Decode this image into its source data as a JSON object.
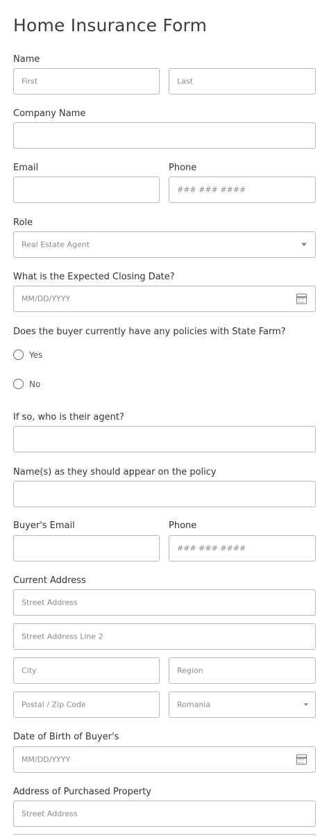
{
  "form": {
    "title": "Home Insurance Form",
    "name": {
      "label": "Name",
      "first_placeholder": "First",
      "last_placeholder": "Last"
    },
    "company": {
      "label": "Company Name"
    },
    "email": {
      "label": "Email"
    },
    "phone": {
      "label": "Phone",
      "placeholder": "### ### ####"
    },
    "role": {
      "label": "Role",
      "selected": "Real Estate Agent"
    },
    "closing_date": {
      "label": "What is the Expected Closing Date?",
      "placeholder": "MM/DD/YYYY"
    },
    "policies": {
      "label": "Does the buyer currently have any policies with State Farm?",
      "options": [
        "Yes",
        "No"
      ]
    },
    "agent": {
      "label": "If so, who is their agent?"
    },
    "policy_names": {
      "label": "Name(s) as they should appear on the policy"
    },
    "buyer_email": {
      "label": "Buyer's Email"
    },
    "buyer_phone": {
      "label": "Phone",
      "placeholder": "### ### ####"
    },
    "current_address": {
      "label": "Current Address",
      "street_placeholder": "Street Address",
      "street2_placeholder": "Street Address Line 2",
      "city_placeholder": "City",
      "region_placeholder": "Region",
      "postal_placeholder": "Postal / Zip Code",
      "country_selected": "Romania"
    },
    "dob": {
      "label": "Date of Birth of Buyer's",
      "placeholder": "MM/DD/YYYY"
    },
    "purchased_address": {
      "label": "Address of Purchased Property",
      "street_placeholder": "Street Address"
    }
  }
}
